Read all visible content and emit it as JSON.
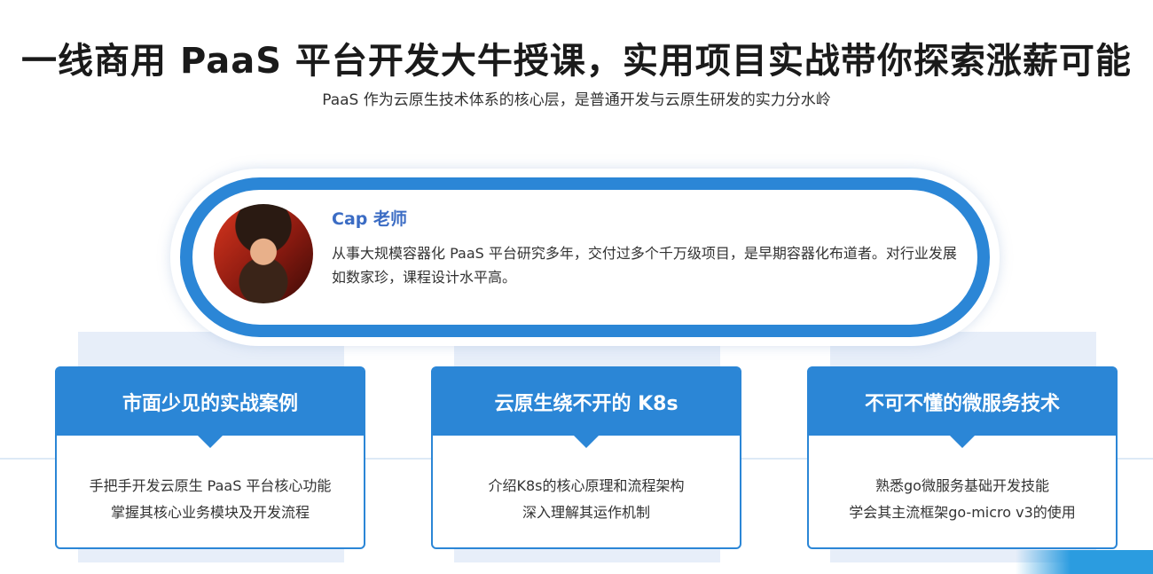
{
  "header": {
    "title": "一线商用 PaaS 平台开发大牛授课，实用项目实战带你探索涨薪可能",
    "subtitle": "PaaS 作为云原生技术体系的核心层，是普通开发与云原生研发的实力分水岭"
  },
  "teacher": {
    "name": "Cap 老师",
    "description": "从事大规模容器化 PaaS 平台研究多年，交付过多个千万级项目，是早期容器化布道者。对行业发展如数家珍，课程设计水平高。"
  },
  "features": [
    {
      "title": "市面少见的实战案例",
      "lines": [
        "手把手开发云原生 PaaS 平台核心功能",
        "掌握其核心业务模块及开发流程"
      ]
    },
    {
      "title": "云原生绕不开的 K8s",
      "lines": [
        "介绍K8s的核心原理和流程架构",
        "深入理解其运作机制"
      ]
    },
    {
      "title": "不可不懂的微服务技术",
      "lines": [
        "熟悉go微服务基础开发技能",
        "学会其主流框架go-micro v3的使用"
      ]
    }
  ],
  "colors": {
    "accent": "#2b86d6",
    "name_blue": "#3b6cc4",
    "back_block": "#e7eef9"
  }
}
